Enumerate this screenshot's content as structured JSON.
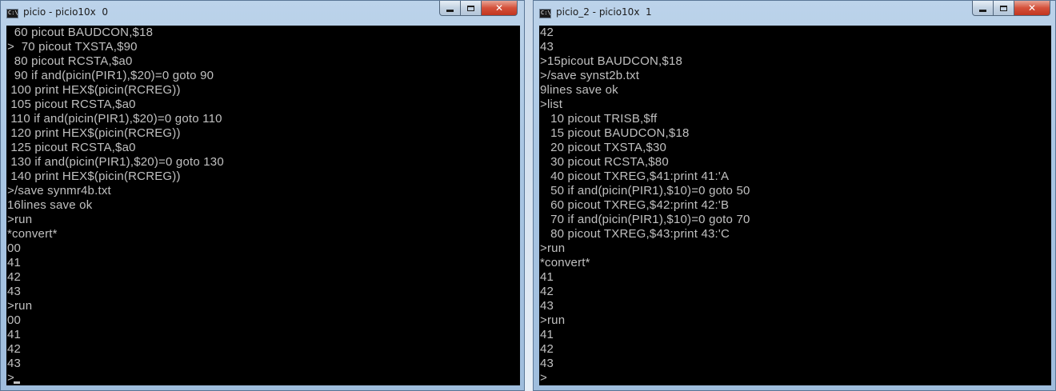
{
  "left_window": {
    "title": "picio - picio10x  0",
    "icon_text": "C:\\",
    "controls": {
      "minimize": "",
      "maximize": "",
      "close": "✕"
    },
    "lines": [
      "  60 picout BAUDCON,$18",
      ">  70 picout TXSTA,$90",
      "  80 picout RCSTA,$a0",
      "  90 if and(picin(PIR1),$20)=0 goto 90",
      " 100 print HEX$(picin(RCREG))",
      " 105 picout RCSTA,$a0",
      " 110 if and(picin(PIR1),$20)=0 goto 110",
      " 120 print HEX$(picin(RCREG))",
      " 125 picout RCSTA,$a0",
      " 130 if and(picin(PIR1),$20)=0 goto 130",
      " 140 print HEX$(picin(RCREG))",
      ">/save synmr4b.txt",
      "16lines save ok",
      ">run",
      "*convert*",
      "00",
      "41",
      "42",
      "43",
      ">run",
      "00",
      "41",
      "42",
      "43",
      ">"
    ]
  },
  "right_window": {
    "title": "picio_2 - picio10x  1",
    "icon_text": "C:\\",
    "controls": {
      "minimize": "",
      "maximize": "",
      "close": "✕"
    },
    "lines": [
      "42",
      "43",
      ">15picout BAUDCON,$18",
      ">/save synst2b.txt",
      "9lines save ok",
      ">list",
      "   10 picout TRISB,$ff",
      "   15 picout BAUDCON,$18",
      "   20 picout TXSTA,$30",
      "   30 picout RCSTA,$80",
      "   40 picout TXREG,$41:print 41:'A",
      "   50 if and(picin(PIR1),$10)=0 goto 50",
      "   60 picout TXREG,$42:print 42:'B",
      "   70 if and(picin(PIR1),$10)=0 goto 70",
      "   80 picout TXREG,$43:print 43:'C",
      ">run",
      "*convert*",
      "41",
      "42",
      "43",
      ">run",
      "41",
      "42",
      "43",
      ">"
    ]
  }
}
